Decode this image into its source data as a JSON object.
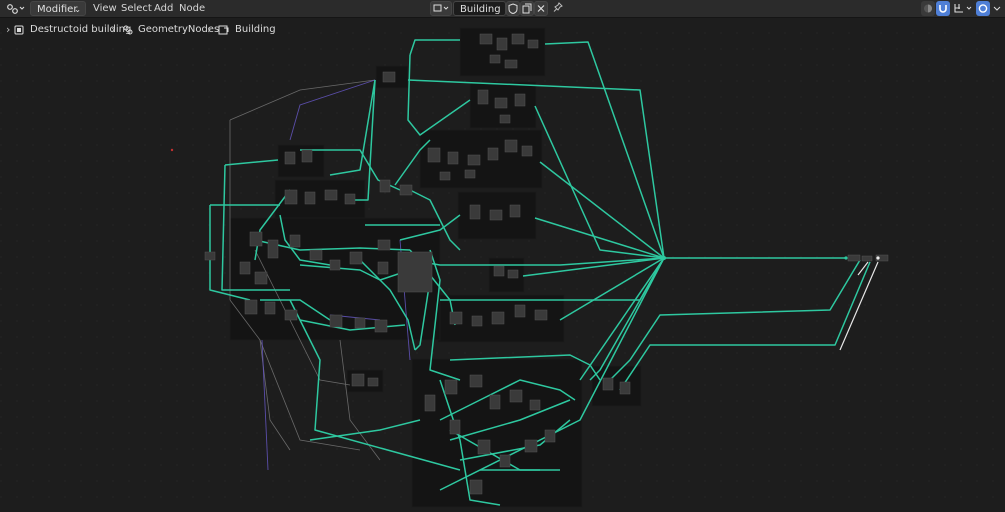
{
  "header": {
    "editor_type_icon": "node-editor-icon",
    "modifier_dropdown": "Modifier",
    "menus": [
      "View",
      "Select",
      "Add",
      "Node"
    ],
    "node_group_name": "Building",
    "pin_icon": "pin-icon",
    "right_icons": [
      "overlay-icon",
      "snap-icon",
      "gizmo-icon",
      "render-icon"
    ]
  },
  "breadcrumb": {
    "items": [
      "Destructoid building",
      "GeometryNodes",
      "Building"
    ]
  },
  "colors": {
    "header_bg": "#2b2b2b",
    "canvas_bg": "#1d1d1d",
    "frame_bg": "#131313",
    "geometry_link": "#2ec8a0",
    "float_link": "#9a9a9a",
    "vector_link": "#6a5acd",
    "accent_blue": "#4f7fd6"
  }
}
